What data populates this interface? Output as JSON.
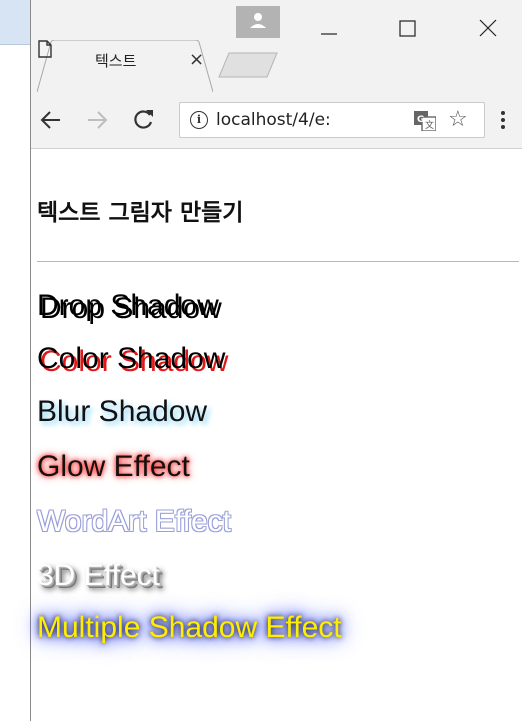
{
  "tab": {
    "title": "텍스트",
    "close": "×"
  },
  "address": {
    "url": "localhost/4/e:"
  },
  "page": {
    "heading": "텍스트 그림자 만들기",
    "effects": [
      {
        "label": "Drop Shadow"
      },
      {
        "label": "Color Shadow"
      },
      {
        "label": "Blur Shadow"
      },
      {
        "label": "Glow Effect"
      },
      {
        "label": "WordArt Effect"
      },
      {
        "label": "3D Effect"
      },
      {
        "label": "Multiple Shadow Effect"
      }
    ]
  },
  "icons": {
    "doc": "document-icon",
    "back": "back-arrow-icon",
    "forward": "forward-arrow-icon",
    "reload": "reload-icon",
    "info": "info-icon",
    "translate": "translate-icon",
    "star": "star-icon",
    "menu": "menu-dots-icon",
    "minimize": "minimize-icon",
    "maximize": "maximize-icon",
    "close": "close-icon",
    "avatar": "user-avatar-icon"
  },
  "colors": {
    "chrome": "#f2f2f2",
    "color_shadow": "#e01818",
    "glow": "#ff1a1a",
    "multi_text": "#ffee00"
  }
}
